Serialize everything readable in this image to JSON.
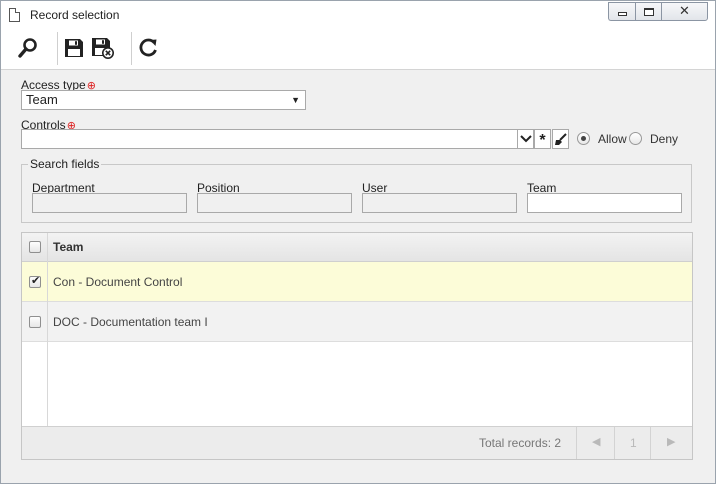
{
  "window": {
    "title": "Record selection",
    "icons": {
      "title": "document-icon",
      "minimize": "minimize-icon",
      "maximize": "maximize-icon",
      "close": "close-icon"
    }
  },
  "toolbar": {
    "icons": [
      "search-icon",
      "save-icon",
      "save-and-close-icon",
      "refresh-icon"
    ]
  },
  "form": {
    "access_type": {
      "label": "Access type",
      "value": "Team"
    },
    "controls": {
      "label": "Controls",
      "value": "",
      "radios": [
        {
          "label": "Allow",
          "checked": true
        },
        {
          "label": "Deny",
          "checked": false
        }
      ]
    }
  },
  "search_fields": {
    "legend": "Search fields",
    "fields": [
      {
        "label": "Department",
        "value": ""
      },
      {
        "label": "Position",
        "value": ""
      },
      {
        "label": "User",
        "value": ""
      },
      {
        "label": "Team",
        "value": ""
      }
    ]
  },
  "grid": {
    "column": "Team",
    "rows": [
      {
        "text": "Con - Document Control",
        "checked": true
      },
      {
        "text": "DOC - Documentation team I",
        "checked": false
      }
    ],
    "footer": {
      "total": "Total records: 2",
      "page": "1"
    }
  },
  "colors": {
    "selected_row": "#fcfcd8",
    "required": "#dd2222"
  }
}
